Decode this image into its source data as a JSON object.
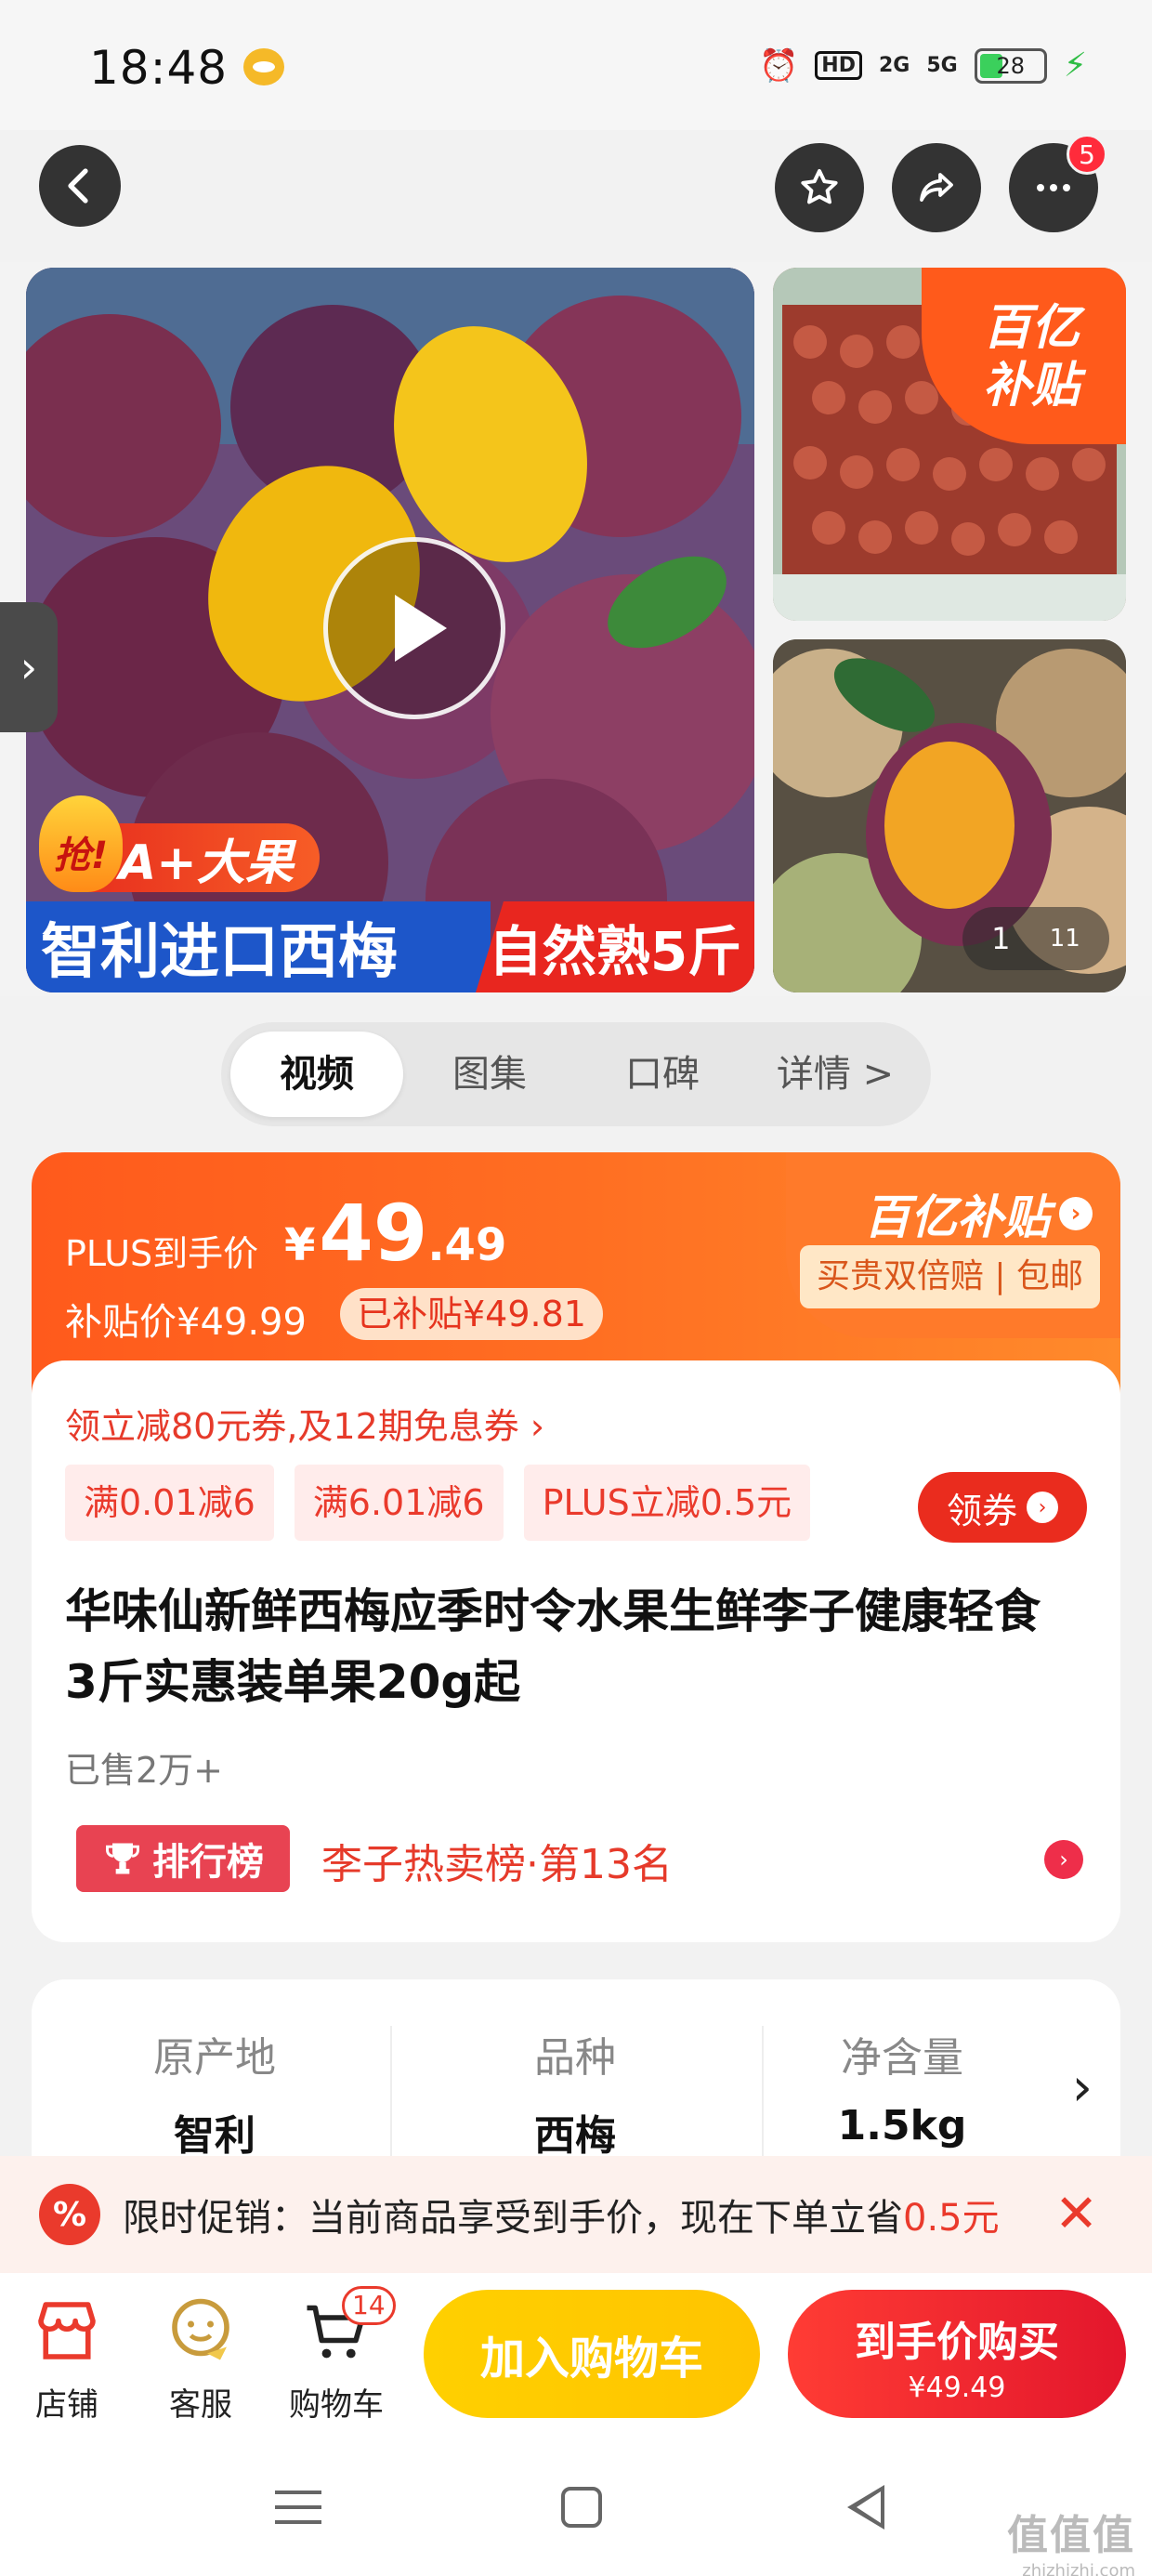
{
  "status_bar": {
    "time": "18:48",
    "hd_label": "HD",
    "net_2g": "2G",
    "net_5g": "5G",
    "battery": "28"
  },
  "nav": {
    "more_badge": "5"
  },
  "gallery": {
    "promo_tag_prefix": "抢!",
    "promo_tag": "A+大果",
    "banner_left": "智利进口西梅",
    "banner_right": "自然熟5斤",
    "subsidy_badge_line1": "百亿",
    "subsidy_badge_line2": "补贴",
    "counter_current": "1",
    "counter_total": "11"
  },
  "tabs": [
    {
      "label": "视频"
    },
    {
      "label": "图集"
    },
    {
      "label": "口碑"
    },
    {
      "label": "详情 >"
    }
  ],
  "price": {
    "plus_label": "PLUS到手价",
    "currency": "¥",
    "int_part": "49",
    "dec_part": ".49",
    "subsidy_label": "补贴价¥49.99",
    "subsidy_chip": "已补贴¥49.81",
    "brand_logo": "百亿补贴",
    "brand_sub": "买贵双倍赔 | 包邮"
  },
  "coupons": {
    "line": "领立减80元券,及12期免息券 ›",
    "chips": [
      "满0.01减6",
      "满6.01减6",
      "PLUS立减0.5元"
    ],
    "get_label": "领券"
  },
  "product": {
    "title": "华味仙新鲜西梅应季时令水果生鲜李子健康轻食 3斤实惠装单果20g起",
    "sold": "已售2万+",
    "rank_badge": "排行榜",
    "rank_text": "李子热卖榜·第13名"
  },
  "specs": [
    {
      "key": "原产地",
      "value": "智利"
    },
    {
      "key": "品种",
      "value": "西梅"
    },
    {
      "key": "净含量",
      "value": "1.5kg"
    }
  ],
  "promo": {
    "icon": "%",
    "text": "限时促销：当前商品享受到手价，现在下单立省",
    "highlight": "0.5元"
  },
  "bottom_bar": {
    "store_label": "店铺",
    "service_label": "客服",
    "cart_label": "购物车",
    "cart_badge": "14",
    "add_cart": "加入购物车",
    "buy_line1": "到手价购买",
    "buy_line2": "¥49.49"
  },
  "watermark": {
    "line1": "值值值",
    "line2": "zhizhizhi.com"
  },
  "colors": {
    "accent_red": "#ea3a2c",
    "subsidy_orange": "#ff5a1c",
    "cart_yellow": "#ffd000"
  }
}
